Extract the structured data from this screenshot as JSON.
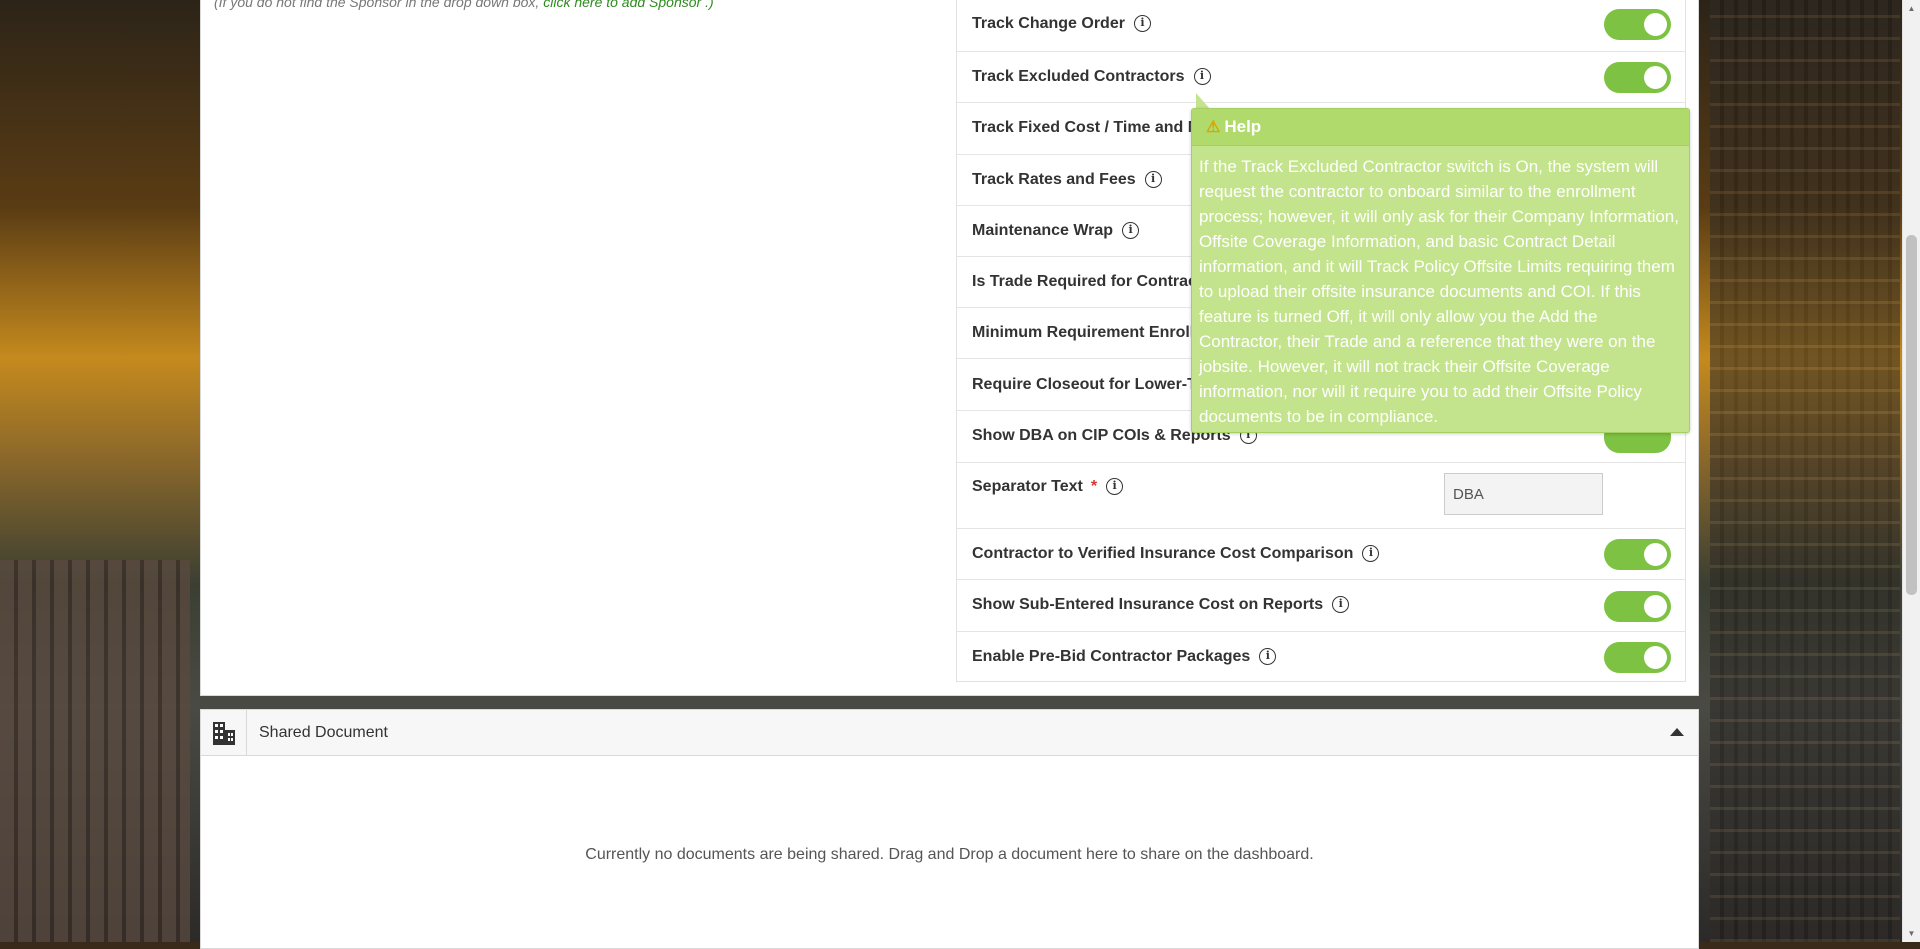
{
  "sponsor_note": {
    "prefix": "(If you do not find the Sponsor in the drop down box,",
    "link": "click here to add Sponsor .)"
  },
  "settings": {
    "rows": [
      {
        "label": "Track Change Order",
        "control": "toggle",
        "on": true
      },
      {
        "label": "Track Excluded Contractors",
        "control": "toggle",
        "on": true
      },
      {
        "label": "Track Fixed Cost / Time and M",
        "control": "toggle"
      },
      {
        "label": "Track Rates and Fees",
        "control": "toggle"
      },
      {
        "label": "Maintenance Wrap",
        "control": "toggle"
      },
      {
        "label": "Is Trade Required for Contract",
        "control": "toggle"
      },
      {
        "label": "Minimum Requirement Enrolln",
        "control": "toggle"
      },
      {
        "label": "Require Closeout for Lower-Ti",
        "control": "toggle"
      },
      {
        "label": "Show DBA on CIP COIs & Reports",
        "control": "toggle",
        "on": true
      },
      {
        "label": "Separator Text",
        "control": "input",
        "required": true,
        "value": "DBA"
      },
      {
        "label": "Contractor to Verified Insurance Cost Comparison",
        "control": "toggle",
        "on": true
      },
      {
        "label": "Show Sub-Entered Insurance Cost on Reports",
        "control": "toggle",
        "on": true
      },
      {
        "label": "Enable Pre-Bid Contractor Packages",
        "control": "toggle",
        "on": true
      }
    ]
  },
  "tooltip": {
    "title": "Help",
    "body": "If the Track Excluded Contractor switch is On, the system will request the contractor to onboard similar to the enrollment process; however, it will only ask for their Company Information, Offsite Coverage Information, and basic Contract Detail information, and it will Track Policy Offsite Limits requiring them to upload their offsite insurance documents and COI. If this feature is turned Off, it will only allow you the Add the Contractor, their Trade and a reference that they were on the jobsite. However, it will not track their Offsite Coverage information, nor will it require you to add their Offsite Policy documents to be in compliance."
  },
  "shared_document": {
    "title": "Shared Document",
    "empty_message": "Currently no documents are being shared. Drag and Drop a document here to share on the dashboard."
  },
  "colors": {
    "toggle_on": "#7dc242",
    "tooltip_bg": "#c3e48c",
    "link": "#2e8b1e"
  }
}
